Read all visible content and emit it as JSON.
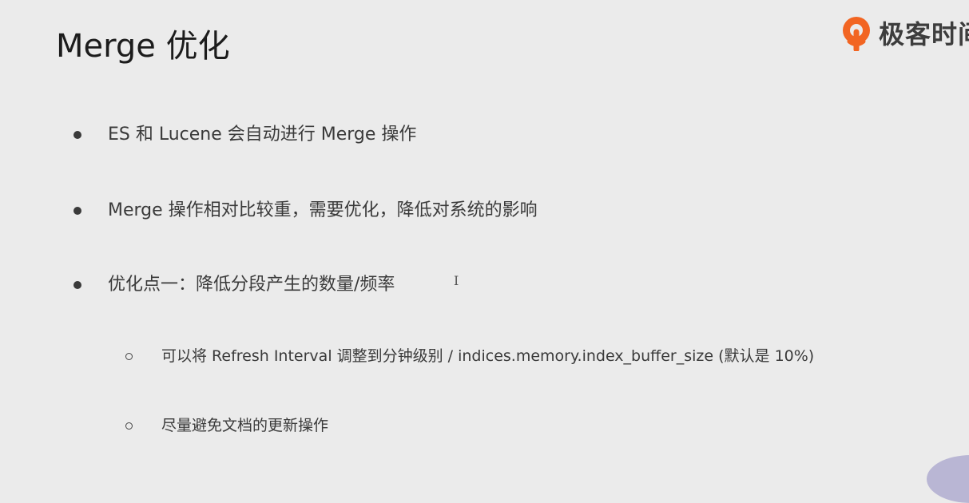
{
  "slide": {
    "title": "Merge 优化",
    "logo": {
      "text": "极客时间",
      "icon": "geektime-logo-icon",
      "accent": "#f26522"
    },
    "bullets": [
      {
        "level": 1,
        "text": "ES 和 Lucene 会自动进行 Merge 操作"
      },
      {
        "level": 1,
        "text": "Merge 操作相对比较重，需要优化，降低对系统的影响"
      },
      {
        "level": 1,
        "text": "优化点一：降低分段产生的数量/频率"
      },
      {
        "level": 2,
        "text": "可以将 Refresh Interval 调整到分钟级别 /   indices.memory.index_buffer_size (默认是 10%)"
      },
      {
        "level": 2,
        "text": "尽量避免文档的更新操作"
      }
    ],
    "cursor_glyph": "I"
  }
}
